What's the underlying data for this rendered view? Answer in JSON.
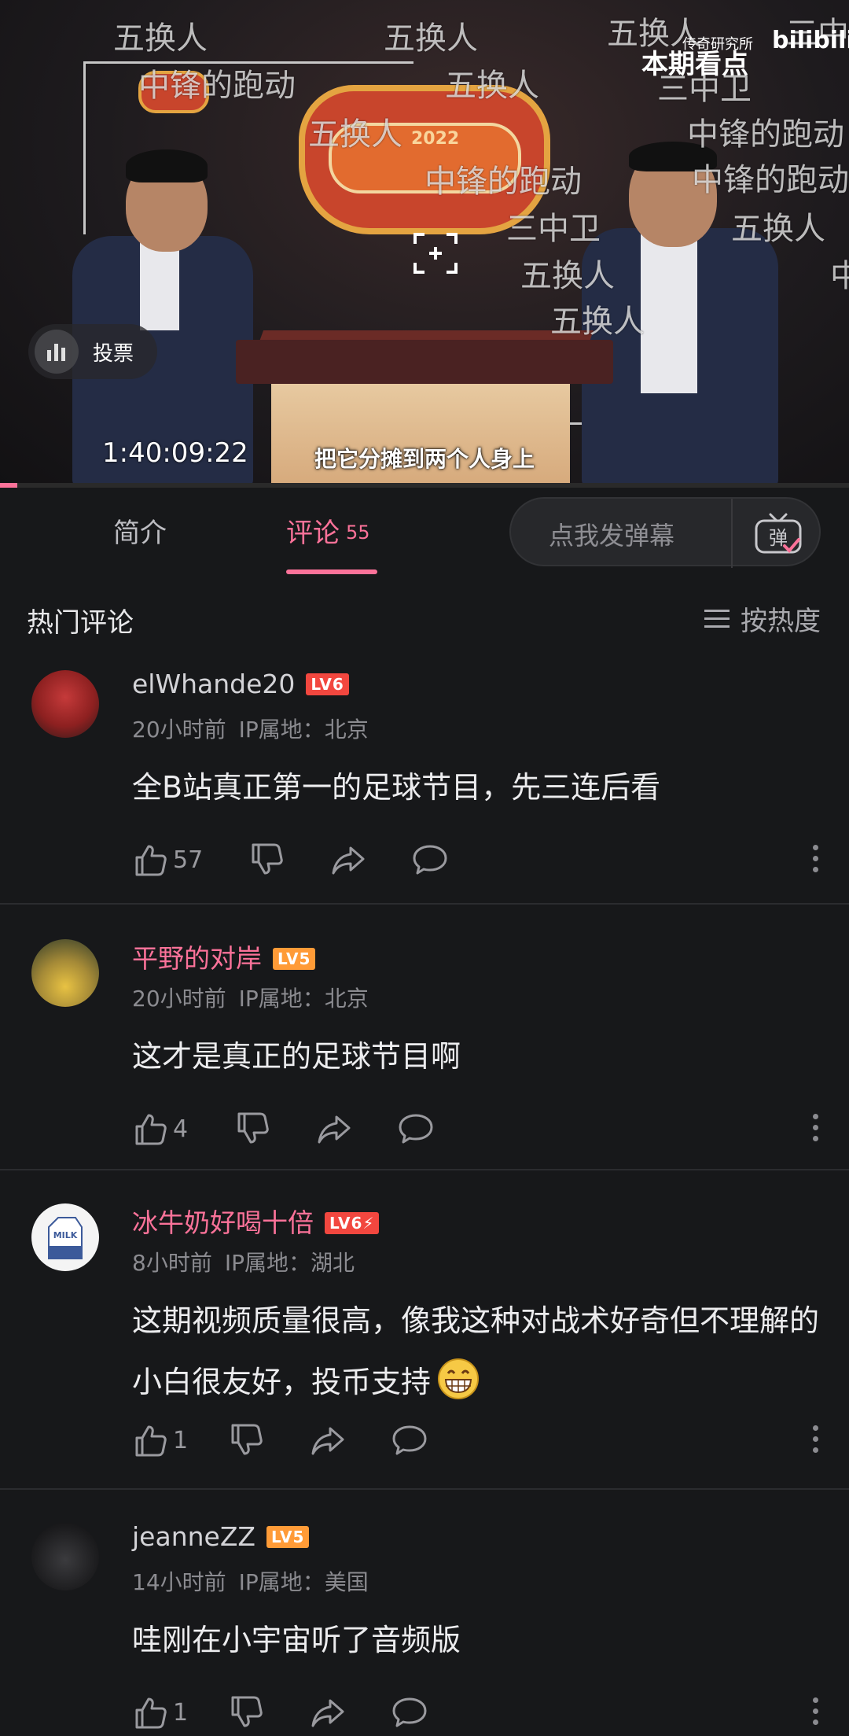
{
  "video": {
    "danmaku": [
      "五换人",
      "五换人",
      "五换人",
      "五换人",
      "中锋的跑动",
      "五换人",
      "三中卫",
      "中锋的跑动",
      "中锋的跑动",
      "中锋的跑动",
      "三中卫",
      "五换人",
      "五换人",
      "五换人",
      "三中",
      "中"
    ],
    "brand_top": "本期看点",
    "brand_small": "传奇研究所",
    "platform_logo": "bilibili",
    "vote_label": "投票",
    "vote_icon": "bar-chart-icon",
    "timecode": "1:40:09:22",
    "subtitle": "把它分摊到两个人身上",
    "logo_year": "2022",
    "progress": 0.02
  },
  "tabs": {
    "intro": "简介",
    "comments": "评论",
    "comments_count": "55",
    "danmaku_placeholder": "点我发弹幕",
    "danmaku_button_glyph": "弹"
  },
  "hot": {
    "title": "热门评论",
    "sort_label": "按热度"
  },
  "comments": [
    {
      "username": "elWhande20",
      "level": "LV6",
      "time": "20小时前",
      "ip": "IP属地：北京",
      "content": "全B站真正第一的足球节目，先三连后看",
      "likes": "57"
    },
    {
      "username": "平野的对岸",
      "level": "LV5",
      "time": "20小时前",
      "ip": "IP属地：北京",
      "content": "这才是真正的足球节目啊",
      "likes": "4"
    },
    {
      "username": "冰牛奶好喝十倍",
      "level": "LV6⚡",
      "time": "8小时前",
      "ip": "IP属地：湖北",
      "content": "这期视频质量很高，像我这种对战术好奇但不理解的小白很友好，投币支持",
      "likes": "1",
      "avatar_text": "MILK"
    },
    {
      "username": "jeanneZZ",
      "level": "LV5",
      "time": "14小时前",
      "ip": "IP属地：美国",
      "content": "哇刚在小宇宙听了音频版",
      "likes": "1"
    }
  ],
  "colors": {
    "accent": "#fb7299",
    "background": "#17181a",
    "divider": "#2b2c2f",
    "lv5": "#ff9b37",
    "lv6": "#f2473f"
  }
}
